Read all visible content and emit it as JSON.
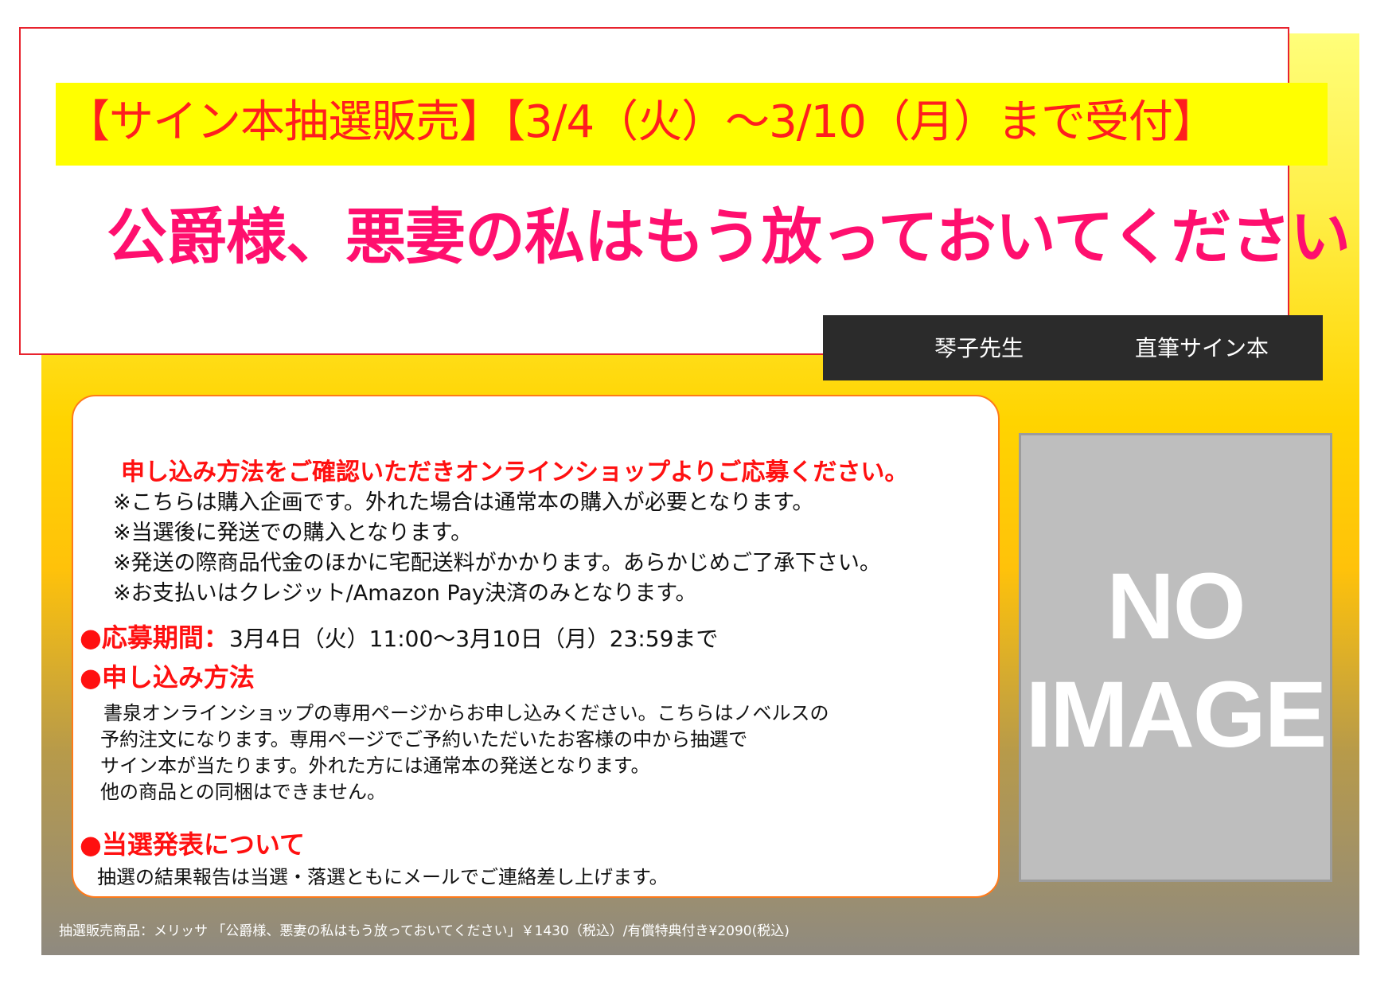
{
  "header": {
    "headline": "【サイン本抽選販売】【3/4（火）～3/10（月）まで受付】",
    "title": "公爵様、悪妻の私はもう放っておいてください",
    "author": "琴子先生",
    "signed_label": "直筆サイン本"
  },
  "info": {
    "lead": "申し込み方法をご確認いただきオンラインショップよりご応募ください。",
    "notes": [
      "※こちらは購入企画です。外れた場合は通常本の購入が必要となります。",
      "※当選後に発送での購入となります。",
      "※発送の際商品代金のほかに宅配送料がかかります。あらかじめご了承下さい。",
      "※お支払いはクレジット/Amazon Pay決済のみとなります。"
    ],
    "period_heading": "●応募期間：",
    "period_value": "3月4日（火）11:00～3月10日（月）23:59まで",
    "method_heading": "●申し込み方法",
    "method_lines": [
      "書泉オンラインショップの専用ページからお申し込みください。こちらはノベルスの",
      "予約注文になります。専用ページでご予約いただいたお客様の中から抽選で",
      "サイン本が当たります。外れた方には通常本の発送となります。",
      "他の商品との同梱はできません。"
    ],
    "result_heading": "●当選発表について",
    "result_line": "抽選の結果報告は当選・落選ともにメールでご連絡差し上げます。"
  },
  "placeholder": {
    "line1": "NO",
    "line2": "IMAGE"
  },
  "footer": {
    "text": "抽選販売商品：メリッサ 「公爵様、悪妻の私はもう放っておいてください」￥1430（税込）/有償特典付き¥2090(税込)"
  },
  "colors": {
    "headline_red": "#ff1e1e",
    "title_pink": "#ff0f6e",
    "highlight_yellow": "#ffff00",
    "author_bar": "#2b2b2b"
  }
}
